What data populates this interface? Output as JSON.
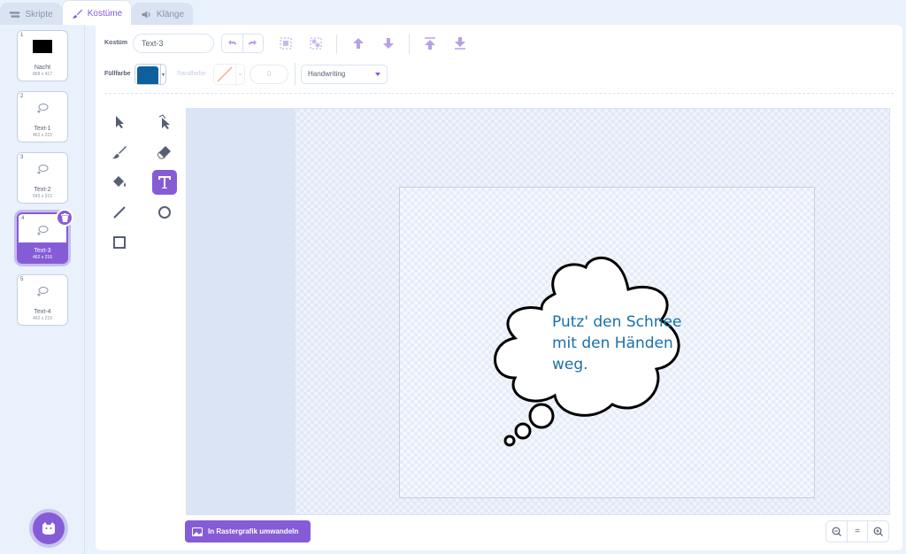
{
  "tabs": [
    {
      "label": "Skripte",
      "icon": "code-icon"
    },
    {
      "label": "Kostüme",
      "icon": "brush-icon"
    },
    {
      "label": "Klänge",
      "icon": "speaker-icon"
    }
  ],
  "costumes": [
    {
      "num": "1",
      "name": "Nacht",
      "size": "868 x 417"
    },
    {
      "num": "2",
      "name": "Text-1",
      "size": "462 x 215"
    },
    {
      "num": "3",
      "name": "Text-2",
      "size": "543 x 215"
    },
    {
      "num": "4",
      "name": "Text-3",
      "size": "462 x 216"
    },
    {
      "num": "5",
      "name": "Text-4",
      "size": "462 x 215"
    }
  ],
  "toolbar": {
    "costume_label": "Kostüm",
    "costume_name": "Text-3",
    "fill_label": "Füllfarbe",
    "fill_color": "#0e5f9b",
    "outline_label": "Randfarbe",
    "outline_width": "0",
    "font": "Handwriting"
  },
  "canvas": {
    "text": "Putz' den Schnee\nmit den Händen\nweg."
  },
  "convert_button": "In Rastergrafik umwandeln",
  "zoom": {
    "out": "−",
    "reset": "=",
    "in": "+"
  },
  "colors": {
    "accent": "#855cd6",
    "text": "#575e75"
  }
}
